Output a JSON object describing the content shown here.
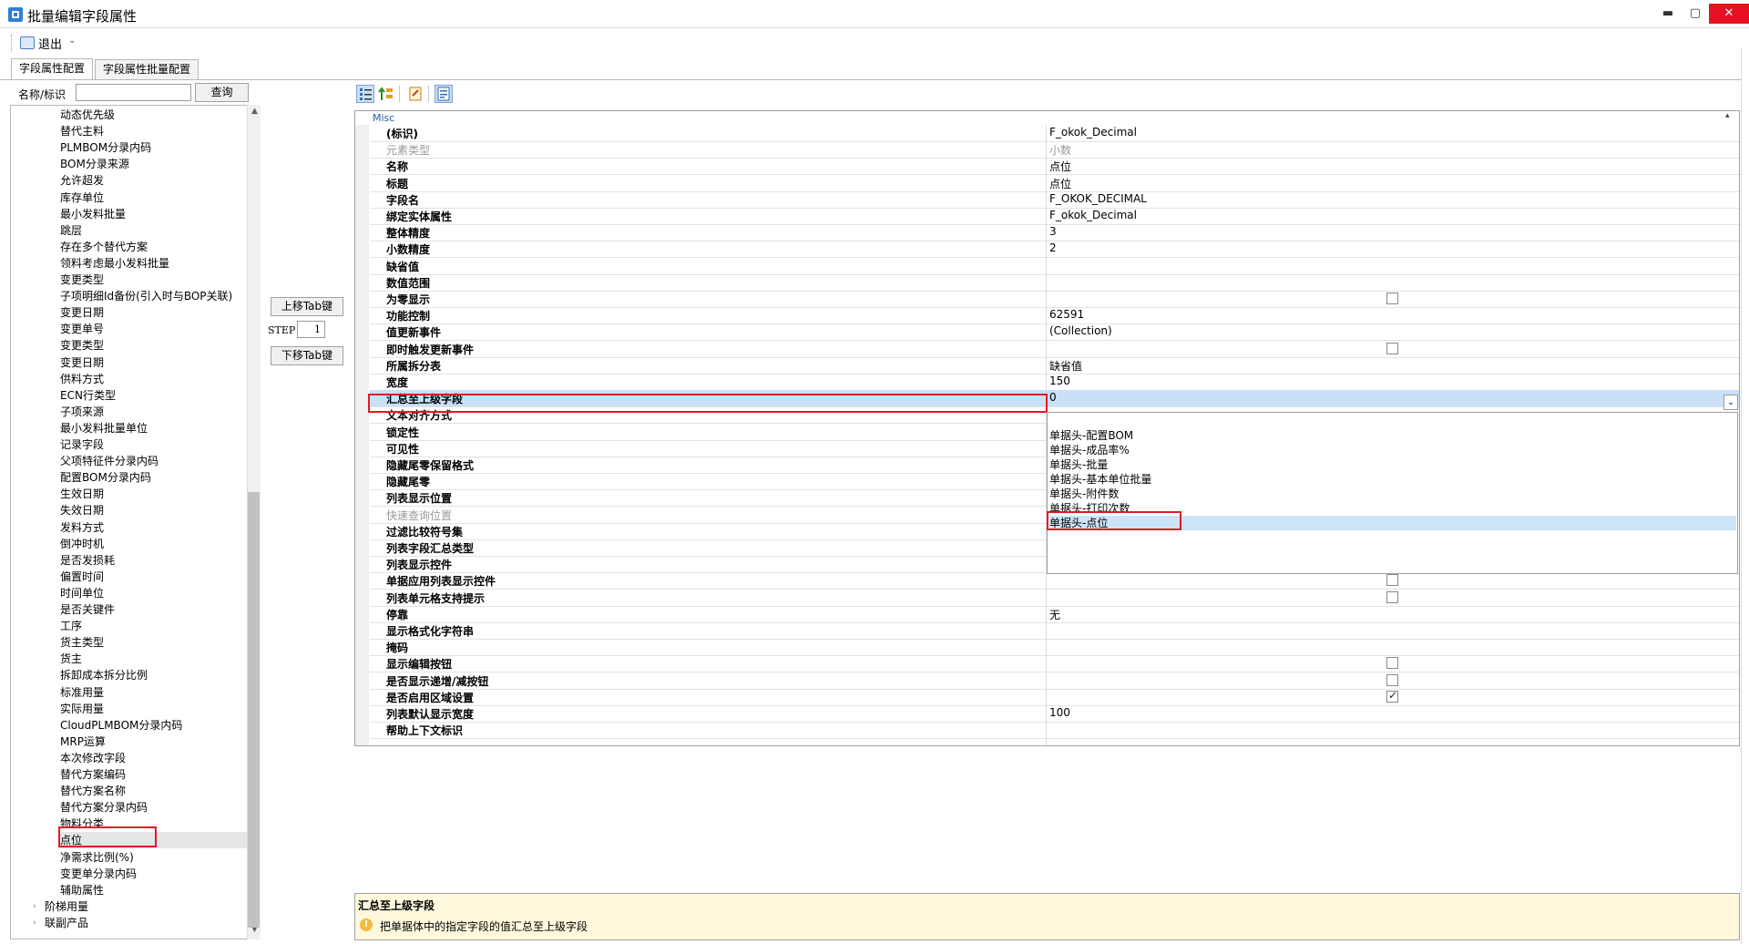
{
  "window": {
    "title": "批量编辑字段属性",
    "controls": {
      "minimize": "▬",
      "maximize": "▢",
      "close": "✕"
    }
  },
  "toolbar": {
    "exit_label": "退出",
    "exit_dropdown": "⌄"
  },
  "tabs": [
    {
      "label": "字段属性配置",
      "active": true
    },
    {
      "label": "字段属性批量配置",
      "active": false
    }
  ],
  "search": {
    "label": "名称/标识",
    "value": "",
    "query_button": "查询"
  },
  "tree": {
    "items": [
      "动态优先级",
      "替代主料",
      "PLMBOM分录内码",
      "BOM分录来源",
      "允许超发",
      "库存单位",
      "最小发料批量",
      "跳层",
      "存在多个替代方案",
      "领料考虑最小发料批量",
      "变更类型",
      "子项明细Id备份(引入时与BOP关联)",
      "变更日期",
      "变更单号",
      "变更类型",
      "变更日期",
      "供料方式",
      "ECN行类型",
      "子项来源",
      "最小发料批量单位",
      "记录字段",
      "父项特征件分录内码",
      "配置BOM分录内码",
      "生效日期",
      "失效日期",
      "发料方式",
      "倒冲时机",
      "是否发损耗",
      "偏置时间",
      "时间单位",
      "是否关键件",
      "工序",
      "货主类型",
      "货主",
      "拆卸成本拆分比例",
      "标准用量",
      "实际用量",
      "CloudPLMBOM分录内码",
      "MRP运算",
      "本次修改字段",
      "替代方案编码",
      "替代方案名称",
      "替代方案分录内码",
      "物料分类",
      "点位",
      "净需求比例(%)",
      "变更单分录内码",
      "辅助属性"
    ],
    "selected_index": 44,
    "groups": [
      "阶梯用量",
      "联副产品"
    ],
    "arrow": "›"
  },
  "middle": {
    "up_button": "上移Tab键",
    "step_label": "STEP",
    "step_value": "1",
    "down_button": "下移Tab键"
  },
  "grid": {
    "category": "Misc",
    "collapse_icon": "▴",
    "rows": [
      {
        "name": "(标识)",
        "value": "F_okok_Decimal"
      },
      {
        "name": "元素类型",
        "value": "小数",
        "readonly": true
      },
      {
        "name": "名称",
        "value": "点位"
      },
      {
        "name": "标题",
        "value": "点位"
      },
      {
        "name": "字段名",
        "value": "F_OKOK_DECIMAL"
      },
      {
        "name": "绑定实体属性",
        "value": "F_okok_Decimal"
      },
      {
        "name": "整体精度",
        "value": "3"
      },
      {
        "name": "小数精度",
        "value": "2"
      },
      {
        "name": "缺省值",
        "value": ""
      },
      {
        "name": "数值范围",
        "value": ""
      },
      {
        "name": "为零显示",
        "value": "",
        "checkbox": false
      },
      {
        "name": "功能控制",
        "value": "62591"
      },
      {
        "name": "值更新事件",
        "value": "(Collection)"
      },
      {
        "name": "即时触发更新事件",
        "value": "",
        "checkbox": false
      },
      {
        "name": "所属拆分表",
        "value": "缺省值"
      },
      {
        "name": "宽度",
        "value": "150"
      },
      {
        "name": "汇总至上级字段",
        "value": "0",
        "highlighted": true
      },
      {
        "name": "文本对齐方式",
        "value": ""
      },
      {
        "name": "锁定性",
        "value": ""
      },
      {
        "name": "可见性",
        "value": ""
      },
      {
        "name": "隐藏尾零保留格式",
        "value": ""
      },
      {
        "name": "隐藏尾零",
        "value": ""
      },
      {
        "name": "列表显示位置",
        "value": ""
      },
      {
        "name": "快速查询位置",
        "value": "",
        "readonly": true
      },
      {
        "name": "过滤比较符号集",
        "value": ""
      },
      {
        "name": "列表字段汇总类型",
        "value": ""
      },
      {
        "name": "列表显示控件",
        "value": ""
      },
      {
        "name": "单据应用列表显示控件",
        "value": "",
        "checkbox": false
      },
      {
        "name": "列表单元格支持提示",
        "value": "",
        "checkbox": false
      },
      {
        "name": "停靠",
        "value": "无"
      },
      {
        "name": "显示格式化字符串",
        "value": ""
      },
      {
        "name": "掩码",
        "value": ""
      },
      {
        "name": "显示编辑按钮",
        "value": "",
        "checkbox": false
      },
      {
        "name": "是否显示递增/减按钮",
        "value": "",
        "checkbox": false
      },
      {
        "name": "是否启用区域设置",
        "value": "",
        "checkbox": true
      },
      {
        "name": "列表默认显示宽度",
        "value": "100"
      },
      {
        "name": "帮助上下文标识",
        "value": ""
      }
    ],
    "dropdown_arrow": "⌄",
    "dropdown_options": [
      {
        "label": "单据头-配置BOM"
      },
      {
        "label": "单据头-成品率%"
      },
      {
        "label": "单据头-批量"
      },
      {
        "label": "单据头-基本单位批量"
      },
      {
        "label": "单据头-附件数"
      },
      {
        "label": "单据头-打印次数"
      },
      {
        "label": "单据头-点位",
        "selected": true
      }
    ]
  },
  "help": {
    "title": "汇总至上级字段",
    "icon": "!",
    "description": "把单据体中的指定字段的值汇总至上级字段"
  },
  "colors": {
    "highlight_box": "#e01b24",
    "selection": "#c9e0f7",
    "help_bg": "#fff8dc"
  }
}
